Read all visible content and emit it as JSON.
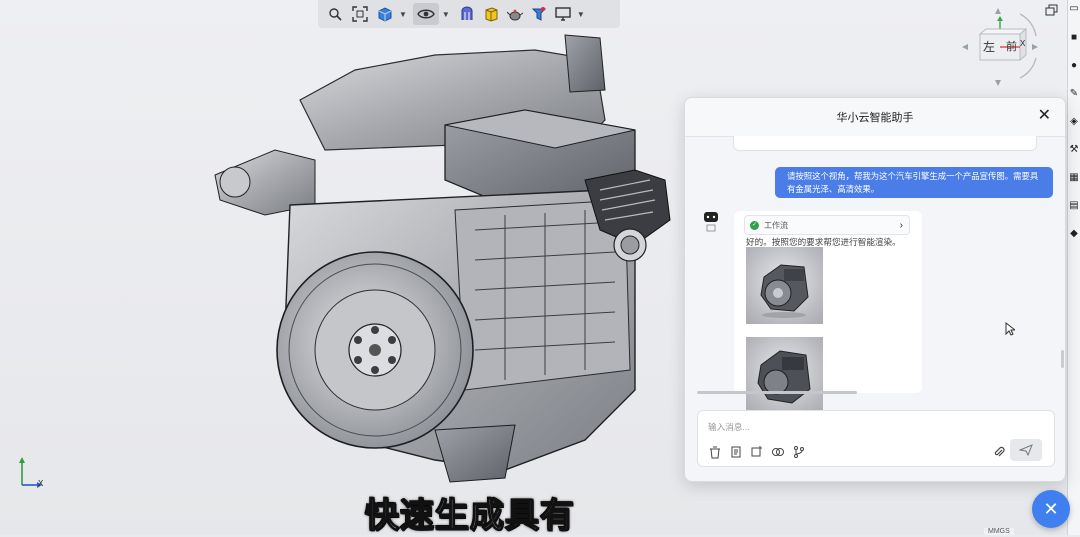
{
  "toolbar": {
    "items": [
      {
        "icon": "zoom-icon"
      },
      {
        "icon": "fit-view-icon"
      },
      {
        "icon": "cube-view-icon"
      },
      {
        "icon": "visibility-eye-icon"
      },
      {
        "icon": "section-icon"
      },
      {
        "icon": "material-box-icon"
      },
      {
        "icon": "render-teapot-icon"
      },
      {
        "icon": "annotation-icon"
      },
      {
        "icon": "display-monitor-icon"
      }
    ]
  },
  "viewcube": {
    "front_label": "左",
    "top_label": "前",
    "axis_label": "X"
  },
  "axis_triad": {
    "x": "X"
  },
  "subtitle": "快速生成具有",
  "chat": {
    "title": "华小云智能助手",
    "close": "✕",
    "user_message": "请按照这个视角，帮我为这个汽车引擎生成一个产品宣传图。需要具有金属光泽、高清效果。",
    "workflow_label": "工作流",
    "bot_reply": "好的。按照您的要求帮您进行智能渲染。",
    "input_placeholder": "输入消息..."
  },
  "fab_label": "✕",
  "status_text": "MMGS",
  "colors": {
    "accent": "#3f7ff0",
    "user_bubble": "#4b7de9",
    "workflow_check": "#2fa24b"
  }
}
